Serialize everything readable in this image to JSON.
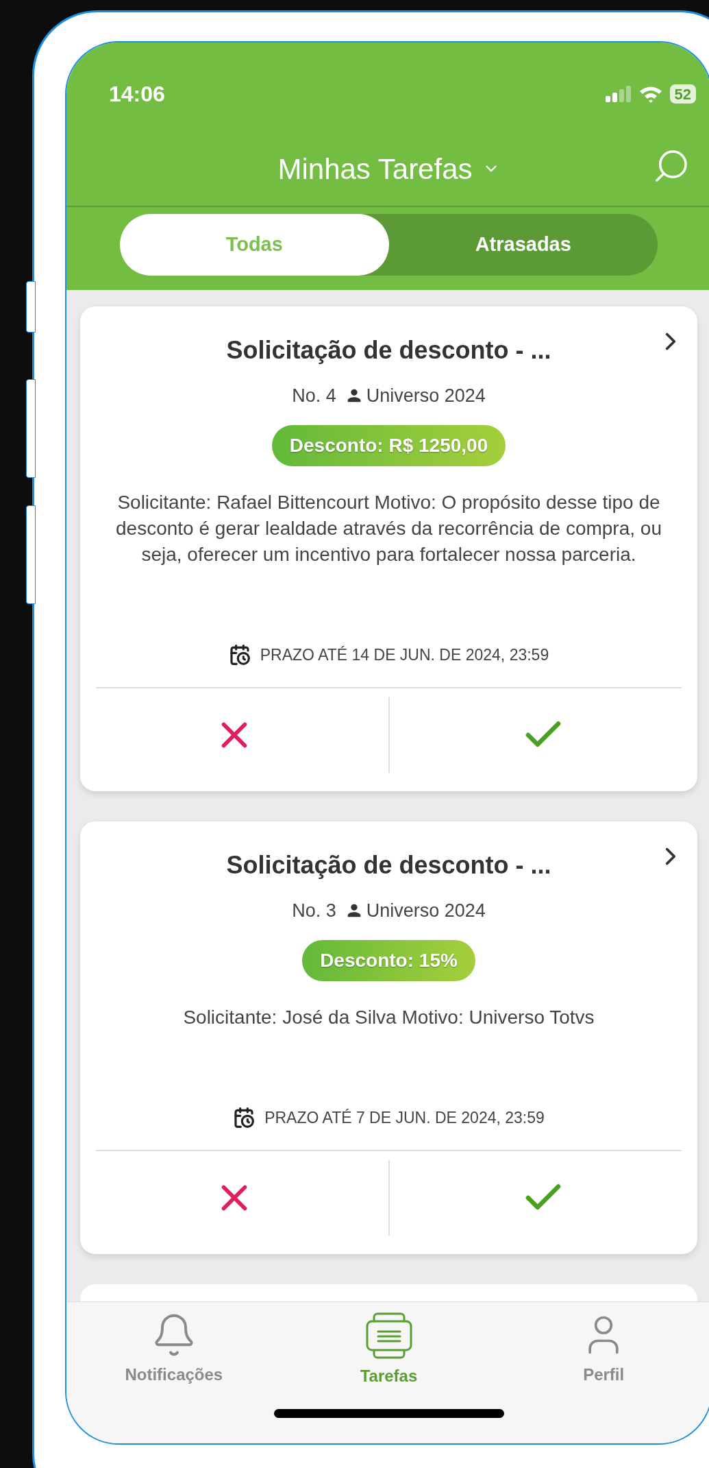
{
  "status_bar": {
    "time": "14:06",
    "battery": "52"
  },
  "header": {
    "title": "Minhas Tarefas"
  },
  "tabs": [
    {
      "label": "Todas",
      "selected": true
    },
    {
      "label": "Atrasadas",
      "selected": false
    }
  ],
  "tasks": [
    {
      "title": "Solicitação de desconto - ...",
      "number": "No. 4",
      "owner": "Universo 2024",
      "badge": "Desconto: R$ 1250,00",
      "description": "Solicitante: Rafael Bittencourt Motivo: O propósito desse tipo de desconto é gerar lealdade através da recorrência de compra, ou seja, oferecer um incentivo para fortalecer nossa parceria.",
      "deadline": "PRAZO ATÉ 14 DE JUN. DE 2024, 23:59"
    },
    {
      "title": "Solicitação de desconto - ...",
      "number": "No. 3",
      "owner": "Universo 2024",
      "badge": "Desconto: 15%",
      "description": "Solicitante: José da Silva Motivo: Universo Totvs",
      "deadline": "PRAZO ATÉ 7 DE JUN. DE 2024, 23:59"
    }
  ],
  "nav": [
    {
      "label": "Notificações",
      "kind": "bell",
      "selected": false
    },
    {
      "label": "Tarefas",
      "kind": "tasks",
      "selected": true
    },
    {
      "label": "Perfil",
      "kind": "profile",
      "selected": false
    }
  ]
}
